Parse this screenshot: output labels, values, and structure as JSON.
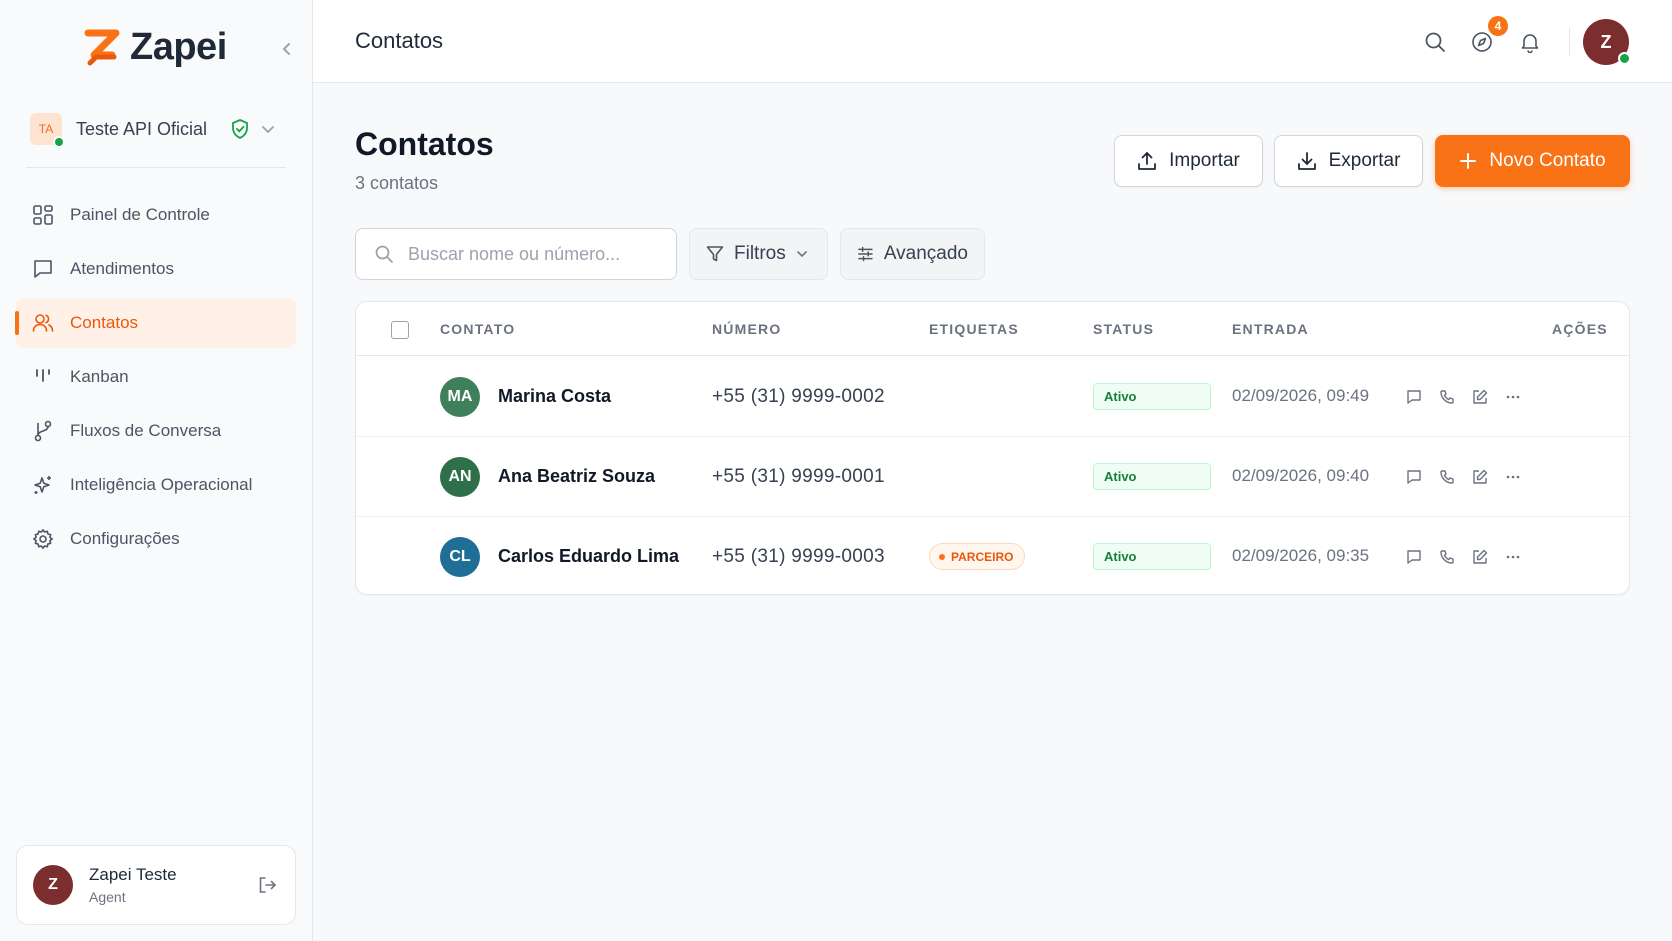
{
  "brand": {
    "name": "Zapei",
    "accent": "#f97316"
  },
  "account": {
    "initials": "TA",
    "name": "Teste API Oficial"
  },
  "nav": {
    "items": [
      {
        "label": "Painel de Controle",
        "icon": "grid-icon"
      },
      {
        "label": "Atendimentos",
        "icon": "chat-icon"
      },
      {
        "label": "Contatos",
        "icon": "users-icon",
        "active": true
      },
      {
        "label": "Kanban",
        "icon": "kanban-icon"
      },
      {
        "label": "Fluxos de Conversa",
        "icon": "branch-icon"
      },
      {
        "label": "Inteligência Operacional",
        "icon": "sparkle-icon"
      },
      {
        "label": "Configurações",
        "icon": "gear-icon"
      }
    ]
  },
  "user": {
    "initial": "Z",
    "name": "Zapei Teste",
    "role": "Agent"
  },
  "topbar": {
    "title": "Contatos",
    "notif_count": "4",
    "avatar_initial": "Z"
  },
  "page": {
    "title": "Contatos",
    "subtitle": "3 contatos",
    "import_label": "Importar",
    "export_label": "Exportar",
    "new_label": "Novo Contato"
  },
  "filters": {
    "search_placeholder": "Buscar nome ou número...",
    "filters_label": "Filtros",
    "advanced_label": "Avançado"
  },
  "table": {
    "headers": {
      "contact": "CONTATO",
      "number": "NÚMERO",
      "tags": "ETIQUETAS",
      "status": "STATUS",
      "entry": "ENTRADA",
      "actions": "AÇÕES"
    },
    "rows": [
      {
        "initials": "MA",
        "avatar_color": "#3f7f5c",
        "name": "Marina Costa",
        "number": "+55 (31) 9999-0002",
        "tag": "",
        "status": "Ativo",
        "entry": "02/09/2026, 09:49"
      },
      {
        "initials": "AN",
        "avatar_color": "#2f6f4a",
        "name": "Ana Beatriz Souza",
        "number": "+55 (31) 9999-0001",
        "tag": "",
        "status": "Ativo",
        "entry": "02/09/2026, 09:40"
      },
      {
        "initials": "CL",
        "avatar_color": "#1f6e95",
        "name": "Carlos Eduardo Lima",
        "number": "+55 (31) 9999-0003",
        "tag": "PARCEIRO",
        "status": "Ativo",
        "entry": "02/09/2026, 09:35"
      }
    ]
  }
}
